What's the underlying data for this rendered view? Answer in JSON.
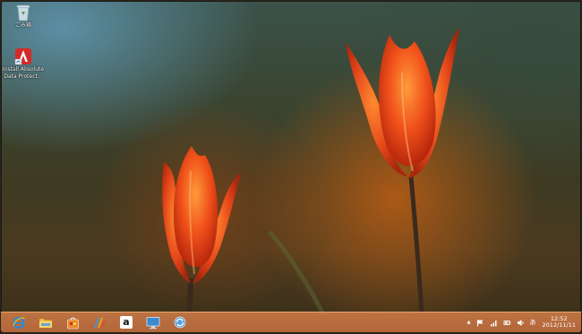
{
  "desktop": {
    "icons": [
      {
        "name": "recycle-bin",
        "label": "ごみ箱"
      },
      {
        "name": "install-absolute-data-protect",
        "label_lines": [
          "Install Absolute",
          "Data Protect..."
        ]
      }
    ]
  },
  "taskbar": {
    "apps": [
      {
        "name": "internet-explorer",
        "icon": "ie-icon"
      },
      {
        "name": "file-explorer",
        "icon": "folder-icon"
      },
      {
        "name": "store-app",
        "icon": "shopping-bag-icon"
      },
      {
        "name": "media-app",
        "icon": "media-icon"
      },
      {
        "name": "amazon",
        "label": "a"
      },
      {
        "name": "remote-desktop",
        "icon": "monitor-icon"
      },
      {
        "name": "sync-app",
        "icon": "sync-icon"
      }
    ],
    "tray": {
      "chevron": "▲",
      "ime": "あ",
      "time": "12:52",
      "date": "2012/11/11"
    }
  }
}
